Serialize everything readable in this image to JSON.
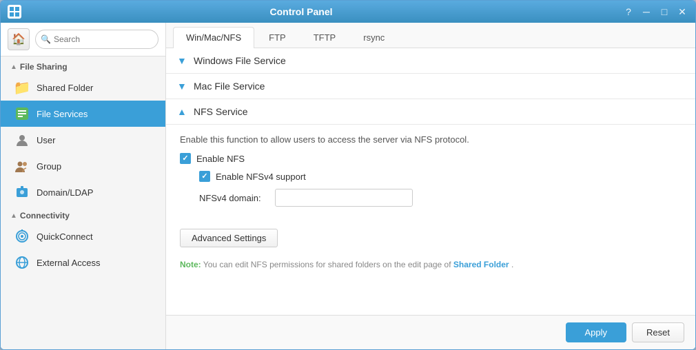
{
  "window": {
    "title": "Control Panel",
    "icon": "≡"
  },
  "sidebar": {
    "search_placeholder": "Search",
    "sections": [
      {
        "id": "file-sharing",
        "label": "File Sharing",
        "collapsed": false,
        "items": [
          {
            "id": "shared-folder",
            "label": "Shared Folder",
            "icon": "folder",
            "active": false
          },
          {
            "id": "file-services",
            "label": "File Services",
            "icon": "file-services",
            "active": true
          }
        ]
      },
      {
        "id": "user-group",
        "label": "",
        "items": [
          {
            "id": "user",
            "label": "User",
            "icon": "user",
            "active": false
          },
          {
            "id": "group",
            "label": "Group",
            "icon": "group",
            "active": false
          },
          {
            "id": "domain-ldap",
            "label": "Domain/LDAP",
            "icon": "ldap",
            "active": false
          }
        ]
      },
      {
        "id": "connectivity",
        "label": "Connectivity",
        "collapsed": false,
        "items": [
          {
            "id": "quickconnect",
            "label": "QuickConnect",
            "icon": "quickconnect",
            "active": false
          },
          {
            "id": "external-access",
            "label": "External Access",
            "icon": "external",
            "active": false
          }
        ]
      }
    ]
  },
  "tabs": [
    {
      "id": "win-mac-nfs",
      "label": "Win/Mac/NFS",
      "active": true
    },
    {
      "id": "ftp",
      "label": "FTP",
      "active": false
    },
    {
      "id": "tftp",
      "label": "TFTP",
      "active": false
    },
    {
      "id": "rsync",
      "label": "rsync",
      "active": false
    }
  ],
  "sections": [
    {
      "id": "windows-file-service",
      "label": "Windows File Service",
      "expanded": false
    },
    {
      "id": "mac-file-service",
      "label": "Mac File Service",
      "expanded": false
    },
    {
      "id": "nfs-service",
      "label": "NFS Service",
      "expanded": true
    }
  ],
  "nfs": {
    "description": "Enable this function to allow users to access the server via NFS protocol.",
    "enable_nfs_label": "Enable NFS",
    "enable_nfsv4_label": "Enable NFSv4 support",
    "nfsv4_domain_label": "NFSv4 domain:",
    "nfsv4_domain_value": "",
    "advanced_settings_label": "Advanced Settings",
    "note_prefix": "Note:",
    "note_text": " You can edit NFS permissions for shared folders on the edit page of ",
    "note_link": "Shared Folder",
    "note_suffix": "."
  },
  "footer": {
    "apply_label": "Apply",
    "reset_label": "Reset"
  }
}
